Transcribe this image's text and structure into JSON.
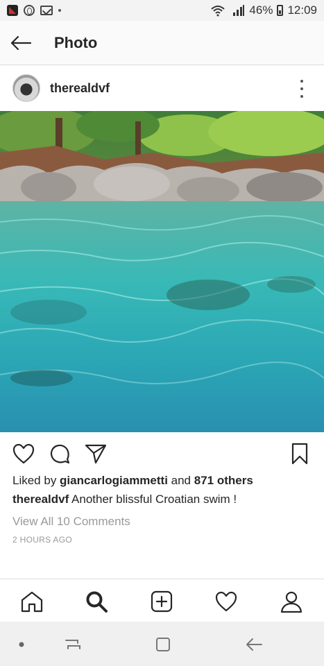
{
  "status_bar": {
    "battery": "46%",
    "time": "12:09"
  },
  "header": {
    "title": "Photo"
  },
  "post": {
    "username": "therealdvf",
    "likes": {
      "prefix": "Liked by ",
      "user": "giancarlogiammetti",
      "middle": " and ",
      "others": "871 others"
    },
    "caption": {
      "user": "therealdvf",
      "text": " Another blissful Croatian swim !"
    },
    "view_comments": "View All 10 Comments",
    "time_ago": "2 HOURS AGO"
  },
  "icons": {
    "back": "arrow-left-icon",
    "more": "more-vertical-icon",
    "like": "heart-icon",
    "comment": "comment-bubble-icon",
    "share": "paper-plane-icon",
    "save": "bookmark-icon",
    "home": "home-icon",
    "search": "search-icon",
    "add": "add-post-icon",
    "activity": "heart-icon",
    "profile": "user-icon"
  },
  "colors": {
    "text": "#262626",
    "muted": "#999999",
    "water": "#2bb3b8"
  }
}
